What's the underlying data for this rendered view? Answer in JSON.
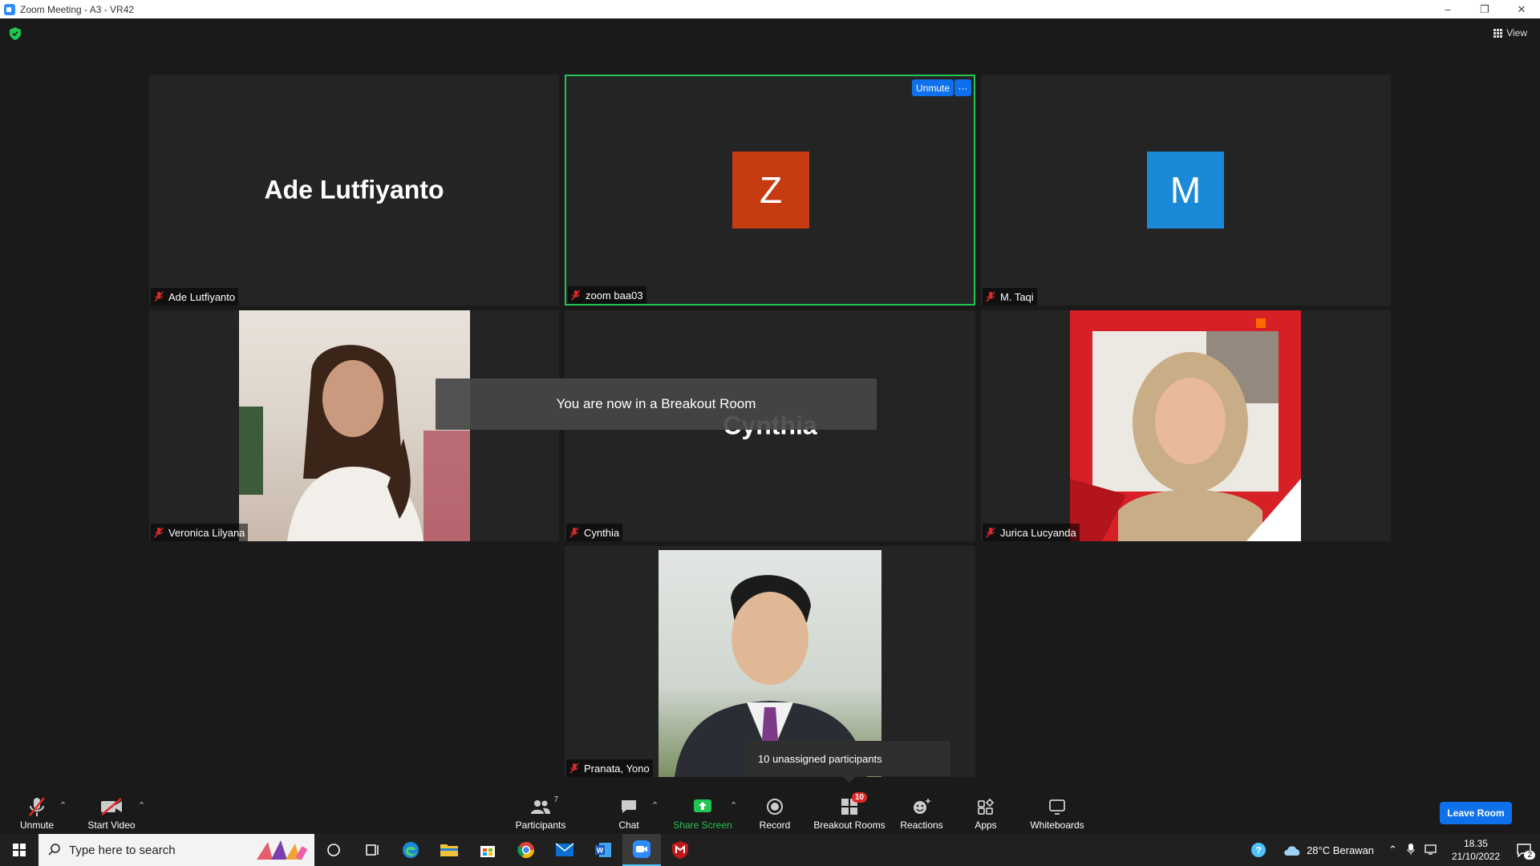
{
  "window": {
    "title": "Zoom Meeting - A3 - VR42"
  },
  "header": {
    "view_label": "View"
  },
  "tiles": [
    {
      "name": "Ade Lutfiyanto",
      "display_name": "Ade Lutfiyanto",
      "type": "name"
    },
    {
      "name": "zoom baa03",
      "avatar_letter": "Z",
      "avatar_color": "#c63b12",
      "type": "avatar"
    },
    {
      "name": "M. Taqi",
      "avatar_letter": "M",
      "avatar_color": "#1a8ad8",
      "type": "avatar"
    },
    {
      "name": "Veronica Lilyana",
      "type": "photo"
    },
    {
      "name": "Cynthia",
      "display_name": "Cynthia",
      "type": "name"
    },
    {
      "name": "Jurica Lucyanda",
      "type": "photo"
    },
    {
      "name": "Pranata, Yono",
      "type": "photo"
    }
  ],
  "active_tile": {
    "unmute_label": "Unmute",
    "more_label": "···"
  },
  "banner": {
    "text": "You are now in a Breakout Room"
  },
  "tooltip": {
    "text": "10 unassigned participants"
  },
  "toolbar": {
    "unmute_label": "Unmute",
    "start_video_label": "Start Video",
    "participants_label": "Participants",
    "participants_count": "7",
    "chat_label": "Chat",
    "share_screen_label": "Share Screen",
    "record_label": "Record",
    "breakout_rooms_label": "Breakout Rooms",
    "breakout_badge": "10",
    "reactions_label": "Reactions",
    "apps_label": "Apps",
    "whiteboards_label": "Whiteboards",
    "leave_label": "Leave Room"
  },
  "taskbar": {
    "search_placeholder": "Type here to search",
    "weather": "28°C  Berawan",
    "time": "18.35",
    "date": "21/10/2022",
    "notification_count": "2"
  },
  "colors": {
    "accent": "#0e71eb",
    "share_green": "#23c552",
    "badge_red": "#e02828"
  }
}
